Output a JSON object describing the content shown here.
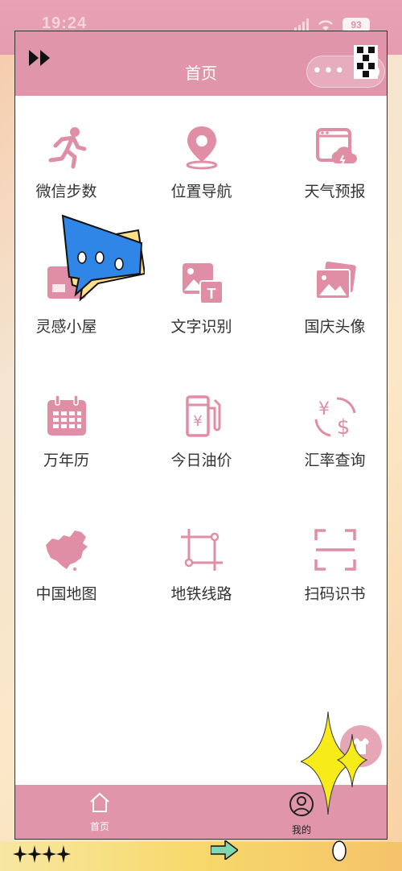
{
  "status_bar": {
    "time": "19:24",
    "battery": "93"
  },
  "header": {
    "title": "首页"
  },
  "capsule": {
    "menu": "•••"
  },
  "grid": {
    "items": [
      {
        "label": "微信步数",
        "icon": "running-person-icon"
      },
      {
        "label": "位置导航",
        "icon": "location-pin-icon"
      },
      {
        "label": "天气预报",
        "icon": "weather-window-icon"
      },
      {
        "label": "灵感小屋",
        "icon": "image-icon"
      },
      {
        "label": "文字识别",
        "icon": "image-text-icon"
      },
      {
        "label": "国庆头像",
        "icon": "photo-stack-icon"
      },
      {
        "label": "万年历",
        "icon": "calendar-icon"
      },
      {
        "label": "今日油价",
        "icon": "fuel-pump-icon"
      },
      {
        "label": "汇率查询",
        "icon": "currency-exchange-icon"
      },
      {
        "label": "中国地图",
        "icon": "china-map-icon"
      },
      {
        "label": "地铁线路",
        "icon": "crop-icon"
      },
      {
        "label": "扫码识书",
        "icon": "scan-icon"
      }
    ]
  },
  "tabbar": {
    "home_label": "首页",
    "mine_label": "我的"
  },
  "colors": {
    "accent": "#e195ab",
    "icon": "#e08ea5",
    "text": "#333333"
  }
}
